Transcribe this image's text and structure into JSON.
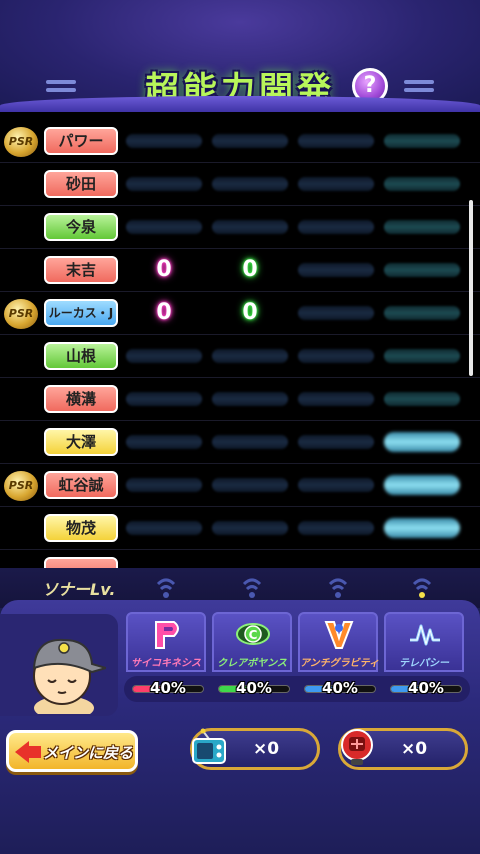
{
  "header": {
    "title": "超能力開発",
    "help_label": "?"
  },
  "players": [
    {
      "name": "パワー",
      "color": "red",
      "psr": true,
      "values": [
        "",
        "",
        "",
        ""
      ],
      "lit": [
        false,
        false,
        false,
        false
      ]
    },
    {
      "name": "砂田",
      "color": "red",
      "psr": false,
      "values": [
        "",
        "",
        "",
        ""
      ],
      "lit": [
        false,
        false,
        false,
        false
      ]
    },
    {
      "name": "今泉",
      "color": "green",
      "psr": false,
      "values": [
        "",
        "",
        "",
        ""
      ],
      "lit": [
        false,
        false,
        false,
        false
      ]
    },
    {
      "name": "末吉",
      "color": "red",
      "psr": false,
      "values": [
        "0",
        "0",
        "",
        ""
      ],
      "lit": [
        false,
        false,
        false,
        false
      ]
    },
    {
      "name": "ルーカス・J",
      "color": "blue",
      "psr": true,
      "values": [
        "0",
        "0",
        "",
        ""
      ],
      "lit": [
        false,
        false,
        false,
        false
      ]
    },
    {
      "name": "山根",
      "color": "green",
      "psr": false,
      "values": [
        "",
        "",
        "",
        ""
      ],
      "lit": [
        false,
        false,
        false,
        false
      ]
    },
    {
      "name": "横溝",
      "color": "red",
      "psr": false,
      "values": [
        "",
        "",
        "",
        ""
      ],
      "lit": [
        false,
        false,
        false,
        false
      ]
    },
    {
      "name": "大澤",
      "color": "yellow",
      "psr": false,
      "values": [
        "",
        "",
        "",
        ""
      ],
      "lit": [
        false,
        false,
        false,
        true
      ]
    },
    {
      "name": "虹谷誠",
      "color": "red",
      "psr": true,
      "values": [
        "",
        "",
        "",
        ""
      ],
      "lit": [
        false,
        false,
        false,
        true
      ]
    },
    {
      "name": "物茂",
      "color": "yellow",
      "psr": false,
      "values": [
        "",
        "",
        "",
        ""
      ],
      "lit": [
        false,
        false,
        false,
        true
      ]
    }
  ],
  "psr_label": "PSR",
  "sonar": {
    "label": "ソナーLv."
  },
  "skills": [
    {
      "name": "サイコキネシス",
      "percent": "40%",
      "fill": 0.4,
      "color": "#ff3f6a",
      "icon": "psychokinesis-icon"
    },
    {
      "name": "クレアボヤンス",
      "percent": "40%",
      "fill": 0.4,
      "color": "#3fd84a",
      "icon": "clairvoyance-eye-icon"
    },
    {
      "name": "アンチグラビティ",
      "percent": "40%",
      "fill": 0.4,
      "color": "#3f9af0",
      "icon": "antigravity-icon"
    },
    {
      "name": "テレパシー",
      "percent": "40%",
      "fill": 0.4,
      "color": "#3f9af0",
      "icon": "telepathy-wave-icon"
    }
  ],
  "buttons": {
    "back": "メインに戻る"
  },
  "items": [
    {
      "icon": "radio-tv-icon",
      "count": "×0"
    },
    {
      "icon": "red-gadget-icon",
      "count": "×0"
    }
  ]
}
